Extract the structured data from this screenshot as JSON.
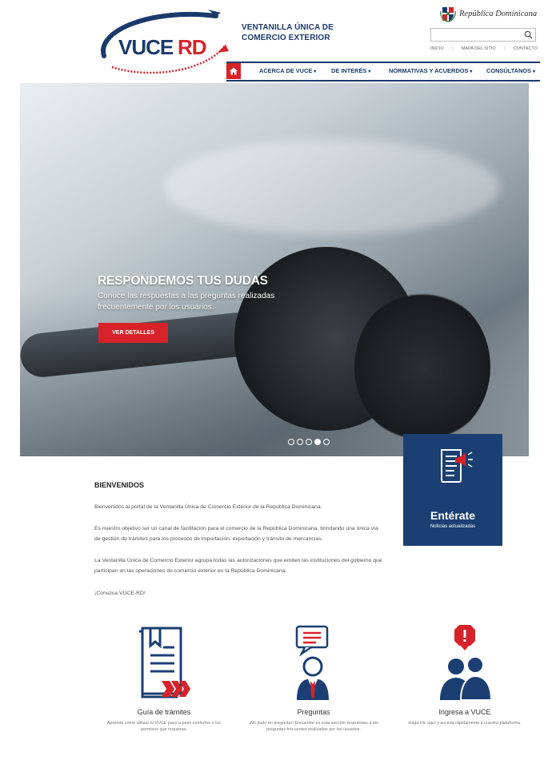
{
  "header": {
    "logo_text": "VUCERD",
    "brand_line1": "VENTANILLA ÚNICA DE",
    "brand_line2": "COMERCIO EXTERIOR",
    "republic": "República Dominicana",
    "search_placeholder": "",
    "links": [
      "INICIO",
      "MAPA DEL SITIO",
      "CONTACTO"
    ]
  },
  "nav": {
    "items": [
      {
        "label": "ACERCA DE VUCE",
        "caret": "▾"
      },
      {
        "label": "DE INTERÉS",
        "caret": "▾"
      },
      {
        "label": "NORMATIVAS Y ACUERDOS",
        "caret": "▾"
      },
      {
        "label": "CONSÚLTANOS",
        "caret": "▾"
      }
    ]
  },
  "hero": {
    "title": "RESPONDEMOS TUS DUDAS",
    "subtitle": "Conoce las respuestas a las preguntas realizadas frecuentemente por los usuarios.",
    "button": "VER DETALLES",
    "slides": 5,
    "active_slide": 4
  },
  "enterate": {
    "title": "Entérate",
    "subtitle": "Noticias actualizadas"
  },
  "welcome": {
    "title": "BIENVENIDOS",
    "p1": "Bienvenidos al portal de la Ventanilla Única de Comercio Exterior de la República Dominicana.",
    "p2": "Es nuestro objetivo ser un canal de facilitación para el comercio de la República Dominicana, brindando una única vía de gestión de trámites para los procesos de importación, exportación y tránsito de mercancías.",
    "p3": "La Ventanilla Única de Comercio Exterior agrupa todas las autorizaciones que emiten las instituciones del gobierno que participan en las operaciones de comercio exterior en la República Dominicana.",
    "p4": "¡Conozca VUCE-RD!"
  },
  "features": [
    {
      "title": "Guía de trámites",
      "desc": "Aprende cómo utilizar la VUCE paso a paso conforme a los permisos que requieras."
    },
    {
      "title": "Preguntas",
      "desc": "¡No dude en preguntar! Encuentre en esta sección respuestas a las preguntas frecuentes realizadas por los usuarios."
    },
    {
      "title": "Ingresa a VUCE",
      "desc": "Haga clic aquí y acceda rápidamente a nuestra plataforma."
    }
  ],
  "colors": {
    "navy": "#1b3a6b",
    "red": "#d7222a",
    "enterate_bg": "#1b3f73"
  }
}
